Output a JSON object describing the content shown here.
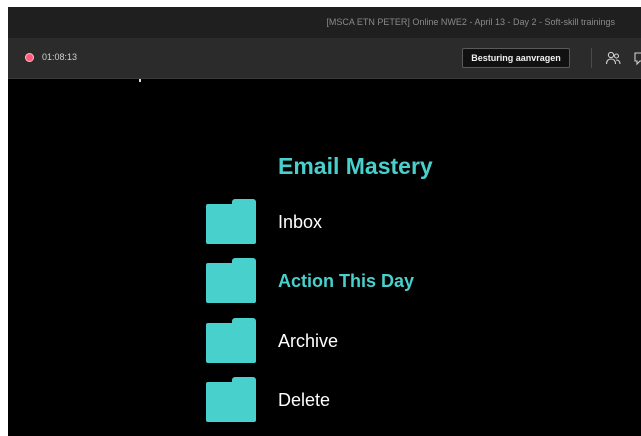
{
  "window": {
    "title": "[MSCA ETN PETER] Online NWE2 - April 13 - Day 2 - Soft-skill trainings"
  },
  "callbar": {
    "timer": "01:08:13",
    "request_control_label": "Besturing aanvragen",
    "icons": [
      "record-indicator-icon",
      "people-icon",
      "chat-icon"
    ]
  },
  "slide": {
    "title": "Email Mastery",
    "accent_color": "#48d0cc",
    "folders": [
      {
        "label": "Inbox",
        "highlighted": false
      },
      {
        "label": "Action This Day",
        "highlighted": true
      },
      {
        "label": "Archive",
        "highlighted": false
      },
      {
        "label": "Delete",
        "highlighted": false
      }
    ]
  }
}
